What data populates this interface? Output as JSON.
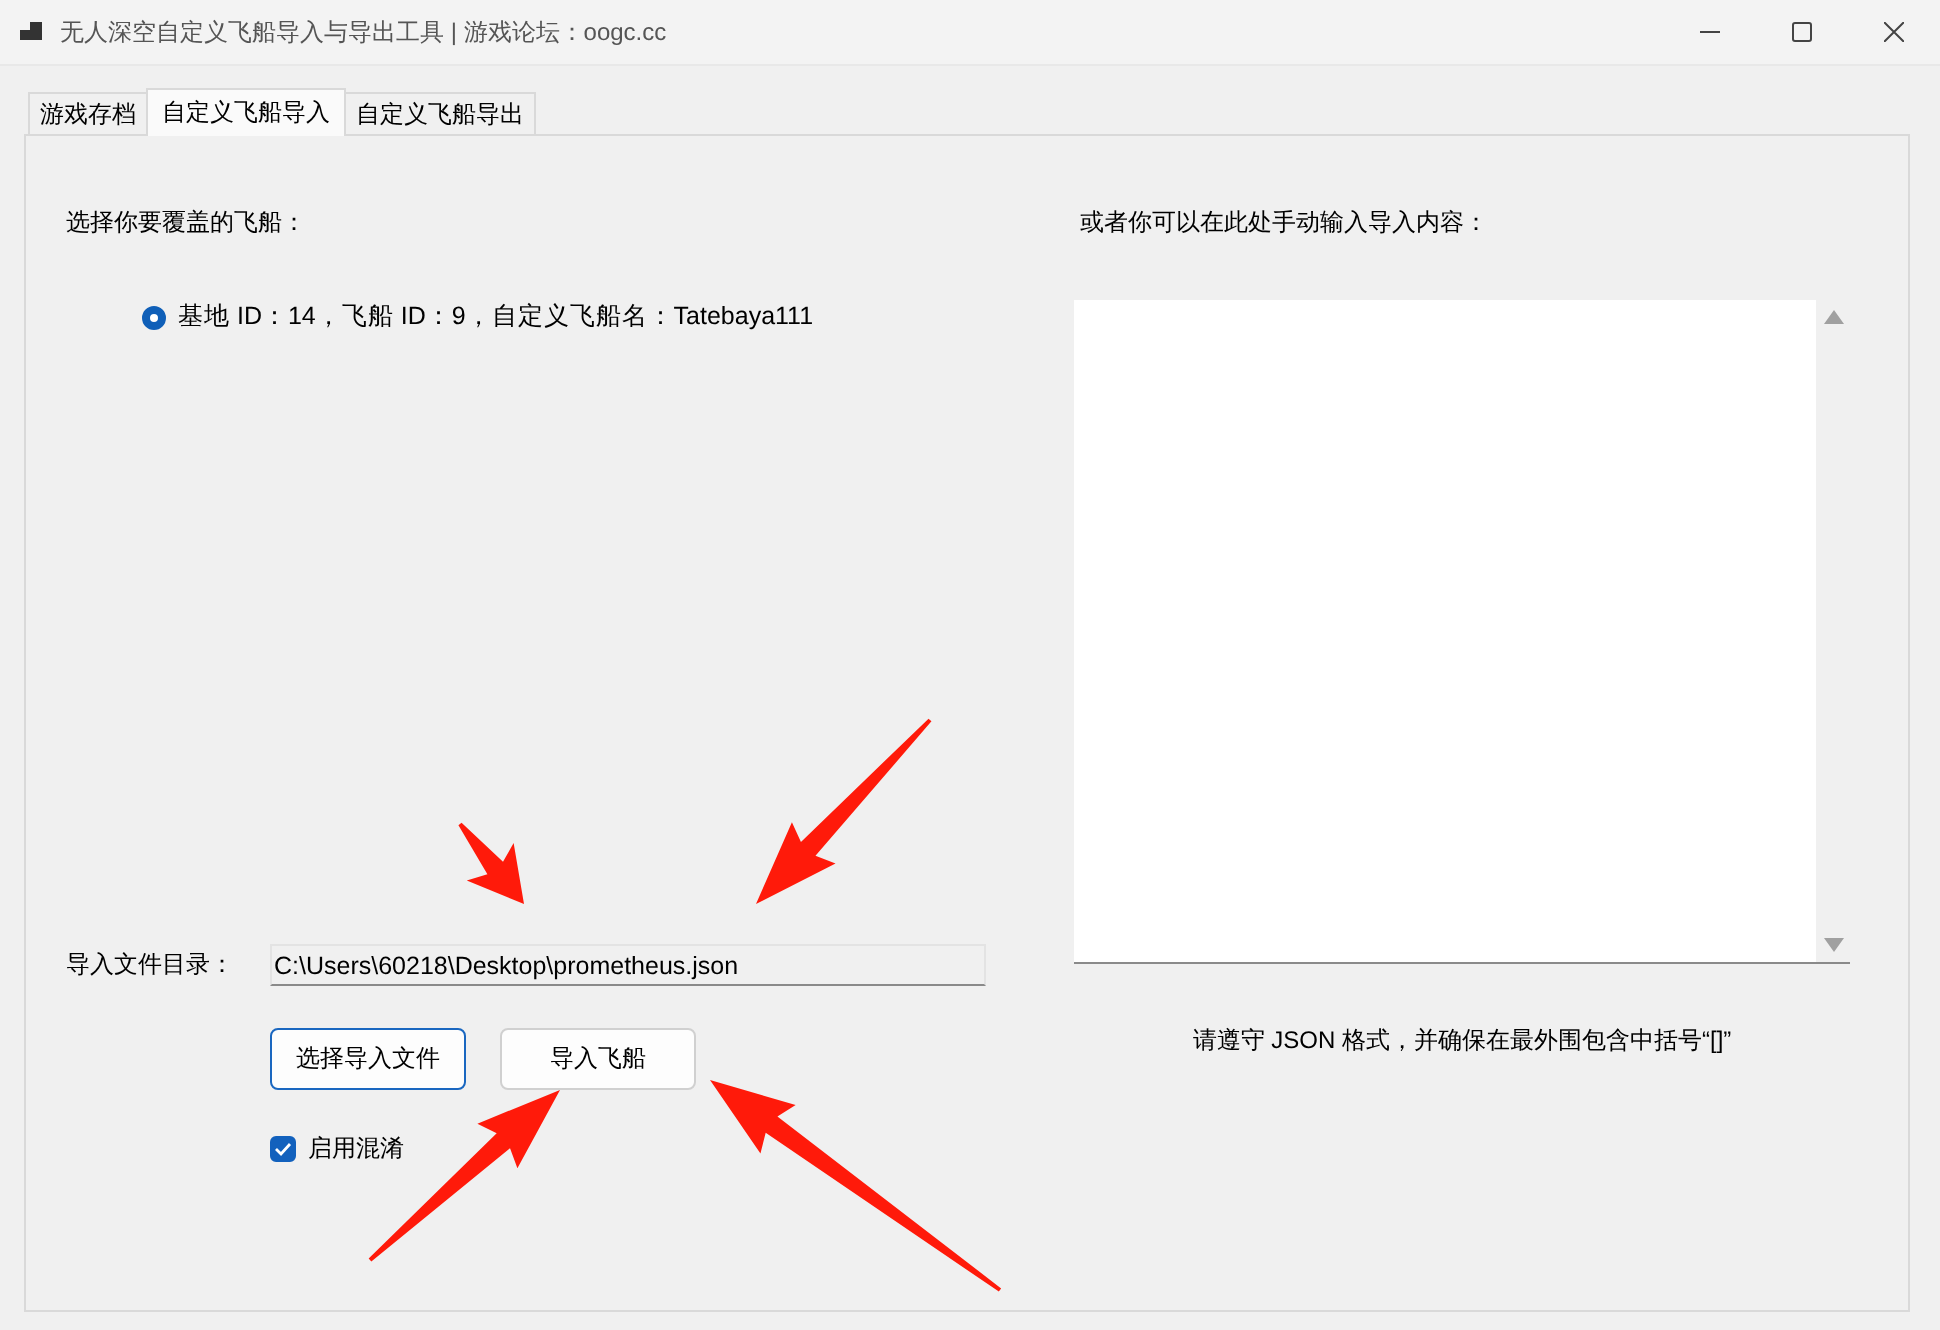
{
  "window": {
    "title": "无人深空自定义飞船导入与导出工具 | 游戏论坛：oogc.cc"
  },
  "tabs": [
    {
      "label": "游戏存档",
      "selected": false
    },
    {
      "label": "自定义飞船导入",
      "selected": true
    },
    {
      "label": "自定义飞船导出",
      "selected": false
    }
  ],
  "left": {
    "ship_label": "选择你要覆盖的飞船：",
    "ships": [
      {
        "label": "基地 ID：14，飞船 ID：9，自定义飞船名：Tatebaya111",
        "selected": true
      }
    ],
    "path_label": "导入文件目录：",
    "path_value": "C:\\Users\\60218\\Desktop\\prometheus.json",
    "buttons": [
      {
        "label": "选择导入文件",
        "focused": true
      },
      {
        "label": "导入飞船",
        "focused": false
      }
    ],
    "obfuscate": {
      "label": "启用混淆",
      "checked": true
    }
  },
  "right": {
    "input_label": "或者你可以在此处手动输入导入内容：",
    "hint": "请遵守 JSON 格式，并确保在最外围包含中括号“[]”"
  }
}
